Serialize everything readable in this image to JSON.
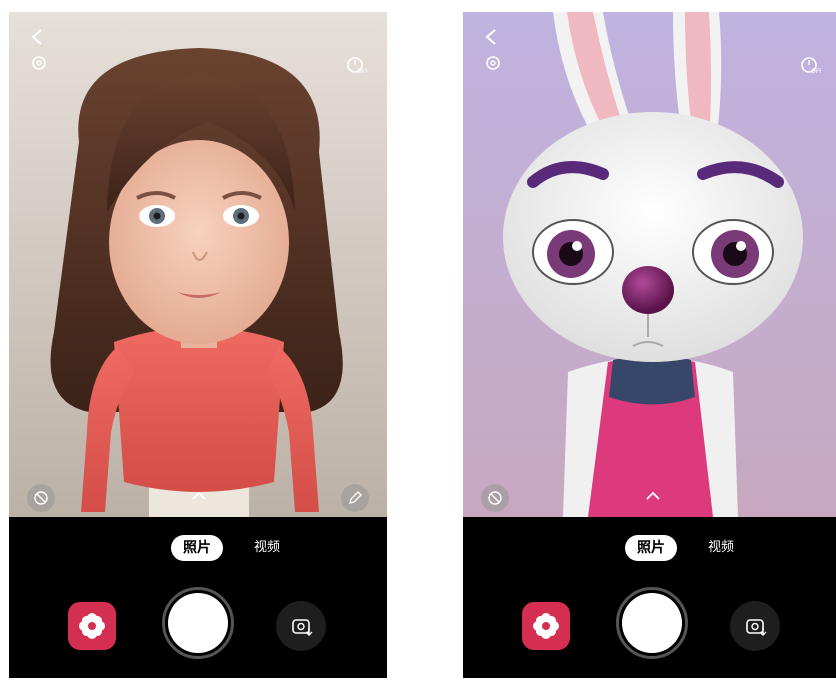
{
  "screens": [
    {
      "id": "avatar-girl",
      "mode_tabs": [
        {
          "label": "照片",
          "active": true
        },
        {
          "label": "视频",
          "active": false
        }
      ],
      "icons": {
        "back": "back-arrow-icon",
        "settings": "gear-icon",
        "timer": "timer-off-icon",
        "bottom_left": "no-sticker-icon",
        "bottom_right": "edit-pencil-icon",
        "expand": "chevron-up-icon",
        "sticker": "flower-sticker-icon",
        "flip": "switch-camera-icon"
      }
    },
    {
      "id": "avatar-rabbit",
      "mode_tabs": [
        {
          "label": "照片",
          "active": true
        },
        {
          "label": "视频",
          "active": false
        }
      ],
      "icons": {
        "back": "back-arrow-icon",
        "settings": "gear-icon",
        "timer": "timer-off-icon",
        "bottom_left": "no-sticker-icon",
        "expand": "chevron-up-icon",
        "sticker": "flower-sticker-icon",
        "flip": "switch-camera-icon"
      }
    }
  ],
  "colors": {
    "sticker_button": "#d42e50",
    "control_bar": "#000000",
    "left_background": "#d8d0c8",
    "right_background": "#c6b8dc"
  }
}
